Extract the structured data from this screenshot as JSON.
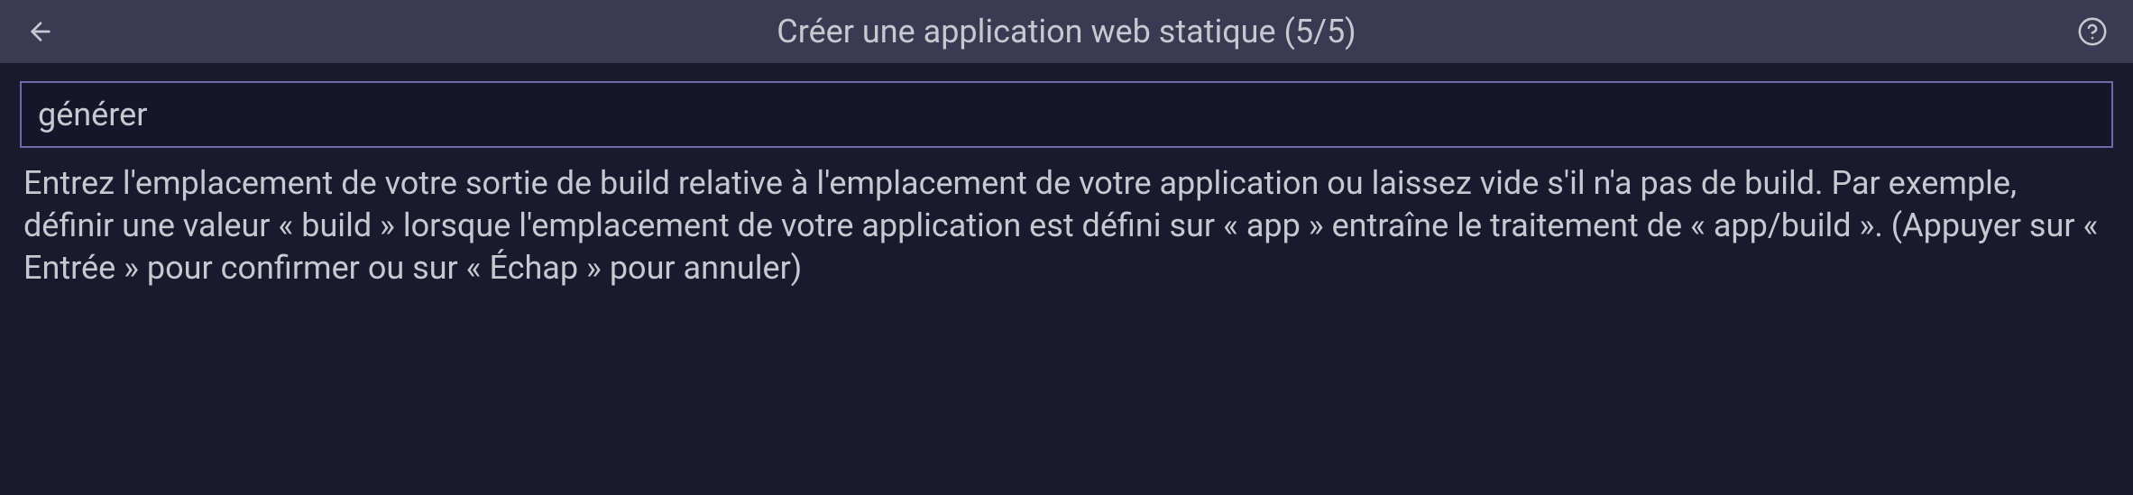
{
  "header": {
    "title": "Créer une application web statique (5/5)"
  },
  "input": {
    "value": "générer"
  },
  "description": "Entrez l'emplacement de votre sortie de build relative à l'emplacement de votre application ou laissez vide s'il n'a pas de build. Par exemple, définir une valeur « build » lorsque l'emplacement de votre application est défini sur « app » entraîne le traitement de « app/build ». (Appuyer sur « Entrée » pour confirmer ou sur « Échap » pour annuler)"
}
